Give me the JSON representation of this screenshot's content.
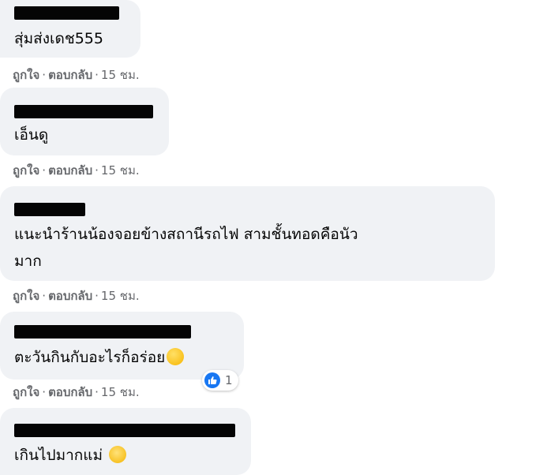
{
  "comments": [
    {
      "text": "สุ่มส่งเดช555",
      "like": "ถูกใจ",
      "reply": "ตอบกลับ",
      "time": "15 ชม."
    },
    {
      "text": "เอ็นดู",
      "like": "ถูกใจ",
      "reply": "ตอบกลับ",
      "time": "15 ชม."
    },
    {
      "text_line1": "แนะนำร้านน้องจอยข้างสถานีรถไฟ สามชั้นทอดคือนัว",
      "text_line2": "มาก",
      "like": "ถูกใจ",
      "reply": "ตอบกลับ",
      "time": "15 ชม."
    },
    {
      "text": "ตะวันกินกับอะไรก็อร่อย",
      "emoji": "rolling-laughing-emoji",
      "reaction_count": "1",
      "like": "ถูกใจ",
      "reply": "ตอบกลับ",
      "time": "15 ชม."
    },
    {
      "text": "เกินไปมากแม่ ",
      "emoji": "relieved-face-emoji"
    }
  ],
  "separator": "·",
  "colors": {
    "bubble": "#f0f2f5",
    "meta": "#65676b",
    "like_blue": "#1877f2"
  }
}
